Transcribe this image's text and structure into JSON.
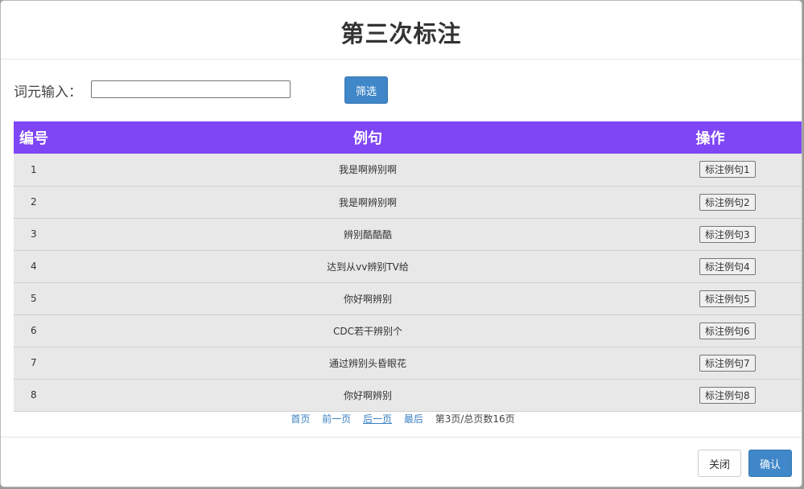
{
  "modal": {
    "title": "第三次标注"
  },
  "filter": {
    "label": "词元输入：",
    "input_value": "",
    "input_placeholder": "",
    "button_label": "筛选"
  },
  "table": {
    "headers": {
      "id": "编号",
      "sentence": "例句",
      "action": "操作"
    },
    "rows": [
      {
        "id": "1",
        "sentence": "我是啊辨别啊",
        "action": "标注例句1"
      },
      {
        "id": "2",
        "sentence": "我是啊辨别啊",
        "action": "标注例句2"
      },
      {
        "id": "3",
        "sentence": "辨别酷酷酷",
        "action": "标注例句3"
      },
      {
        "id": "4",
        "sentence": "达到从vv辨别TV给",
        "action": "标注例句4"
      },
      {
        "id": "5",
        "sentence": "你好啊辨别",
        "action": "标注例句5"
      },
      {
        "id": "6",
        "sentence": "CDC若干辨别个",
        "action": "标注例句6"
      },
      {
        "id": "7",
        "sentence": "通过辨别头昏眼花",
        "action": "标注例句7"
      },
      {
        "id": "8",
        "sentence": "你好啊辨别",
        "action": "标注例句8"
      }
    ]
  },
  "pagination": {
    "first": "首页",
    "prev": "前一页",
    "next": "后一页",
    "last": "最后",
    "info": "第3页/总页数16页"
  },
  "footer": {
    "close_label": "关闭",
    "confirm_label": "确认"
  },
  "colors": {
    "header_bg": "#7f46f5",
    "primary_button": "#3f87c8",
    "link": "#3a80c2",
    "row_bg": "#e8e8e8"
  }
}
